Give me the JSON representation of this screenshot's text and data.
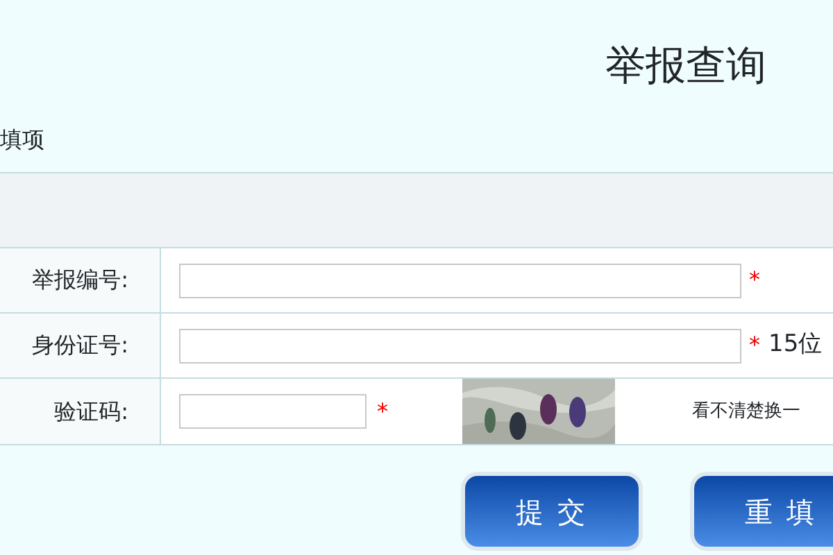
{
  "title": "举报查询",
  "note": "填项",
  "rows": [
    {
      "kind": "text",
      "label": "举报编号:",
      "required": "*"
    },
    {
      "kind": "text",
      "label": "身份证号:",
      "required": "*",
      "hint": "15位"
    },
    {
      "kind": "captcha",
      "label": "验证码:",
      "required": "*",
      "refresh": "看不清楚换一"
    }
  ],
  "buttons": [
    "提 交",
    "重 填"
  ]
}
